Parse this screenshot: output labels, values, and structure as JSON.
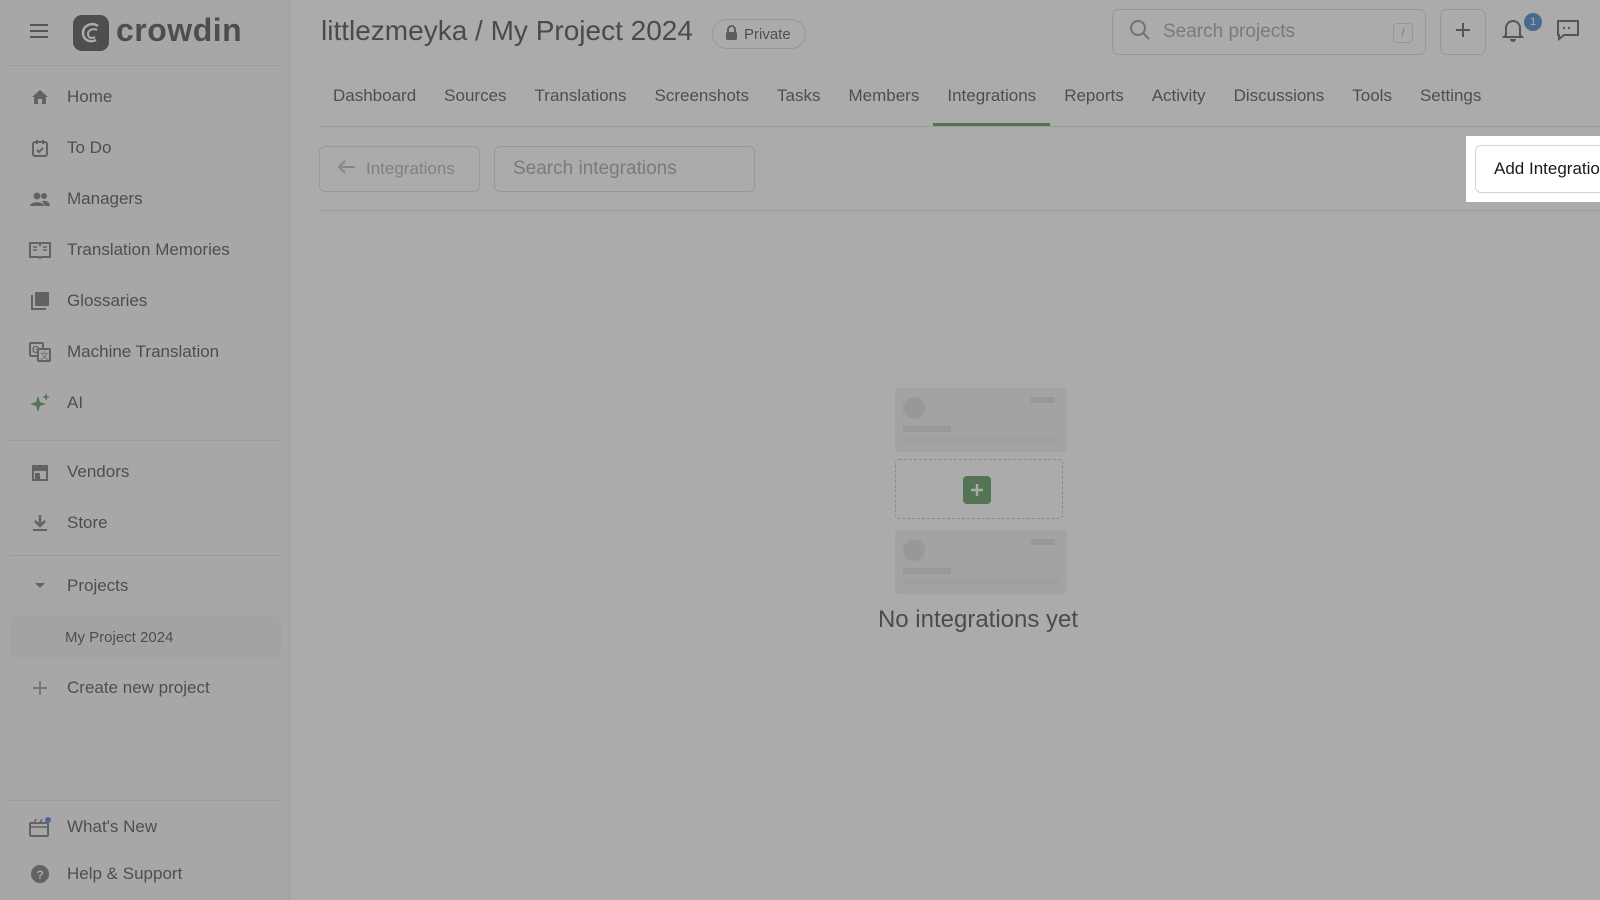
{
  "app": {
    "logo_text": "crowdin",
    "brand_color": "#2e7d32",
    "badge_color": "#1565c0"
  },
  "sidebar": {
    "items": [
      {
        "label": "Home",
        "icon": "home-icon"
      },
      {
        "label": "To Do",
        "icon": "calendar-check-icon"
      },
      {
        "label": "Managers",
        "icon": "people-icon"
      },
      {
        "label": "Translation Memories",
        "icon": "book-icon"
      },
      {
        "label": "Glossaries",
        "icon": "library-icon"
      },
      {
        "label": "Machine Translation",
        "icon": "translate-icon"
      },
      {
        "label": "AI",
        "icon": "sparkle-icon"
      },
      {
        "label": "Vendors",
        "icon": "storefront-icon"
      },
      {
        "label": "Store",
        "icon": "download-icon"
      },
      {
        "label": "Projects",
        "icon": "caret-down-icon"
      },
      {
        "label": "Create new project",
        "icon": "plus-icon"
      }
    ],
    "project_item": "My Project 2024",
    "footer": [
      {
        "label": "What's New",
        "icon": "whats-new-icon"
      },
      {
        "label": "Help & Support",
        "icon": "help-icon"
      }
    ]
  },
  "header": {
    "title": "littlezmeyka / My Project 2024",
    "visibility": "Private",
    "search_placeholder": "Search projects",
    "search_shortcut": "/",
    "notification_count": "1"
  },
  "tabs": [
    {
      "label": "Dashboard"
    },
    {
      "label": "Sources"
    },
    {
      "label": "Translations"
    },
    {
      "label": "Screenshots"
    },
    {
      "label": "Tasks"
    },
    {
      "label": "Members"
    },
    {
      "label": "Integrations",
      "active": true
    },
    {
      "label": "Reports"
    },
    {
      "label": "Activity"
    },
    {
      "label": "Discussions"
    },
    {
      "label": "Tools"
    },
    {
      "label": "Settings"
    }
  ],
  "toolbar": {
    "back_label": "Integrations",
    "search_placeholder": "Search integrations",
    "add_label": "Add Integration"
  },
  "empty_state": {
    "text": "No integrations yet"
  }
}
